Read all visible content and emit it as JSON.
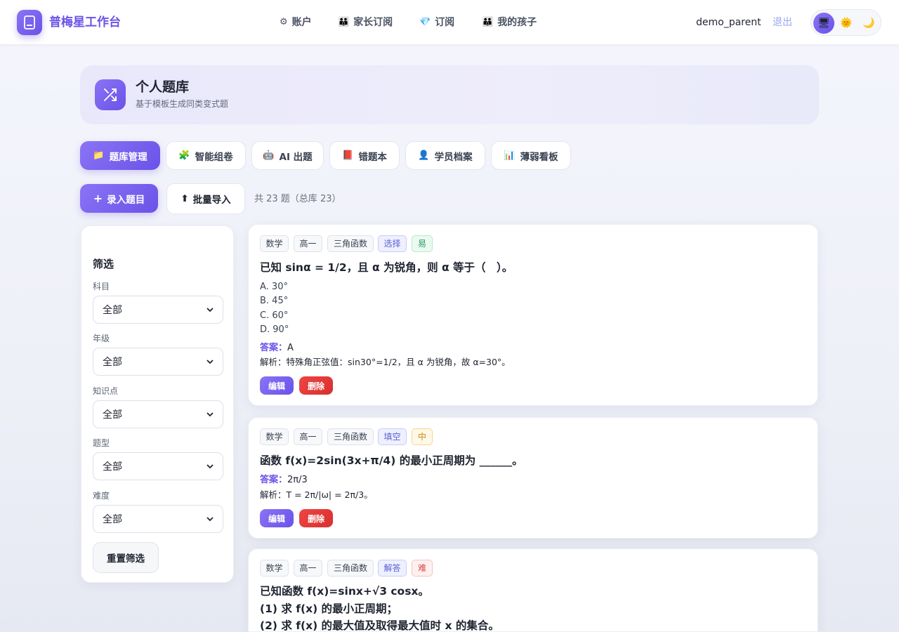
{
  "nav": {
    "brand": "普梅星工作台",
    "links": [
      {
        "icon": "⚙",
        "label": "账户"
      },
      {
        "icon": "👪",
        "label": "家长订阅"
      },
      {
        "icon": "💎",
        "label": "订阅"
      },
      {
        "icon": "👪",
        "label": "我的孩子"
      }
    ],
    "username": "demo_parent",
    "logout": "退出",
    "theme": {
      "system_icon": "🖥",
      "light_icon": "🌞",
      "dark_icon": "🌙"
    }
  },
  "hero": {
    "title": "个人题库",
    "subtitle": "基于模板生成同类变式题"
  },
  "tabs": [
    {
      "icon": "📁",
      "label": "题库管理"
    },
    {
      "icon": "🧩",
      "label": "智能组卷"
    },
    {
      "icon": "🤖",
      "label": "AI 出题"
    },
    {
      "icon": "📕",
      "label": "错题本"
    },
    {
      "icon": "👤",
      "label": "学员档案"
    },
    {
      "icon": "📊",
      "label": "薄弱看板"
    }
  ],
  "actions": {
    "add": "录入题目",
    "add_icon": "+",
    "import": "批量导入",
    "import_icon": "⬆",
    "count": "共 23 题（总库 23）"
  },
  "filter": {
    "title": "筛选",
    "fields": [
      {
        "label": "科目",
        "value": "全部"
      },
      {
        "label": "年级",
        "value": "全部"
      },
      {
        "label": "知识点",
        "value": "全部"
      },
      {
        "label": "题型",
        "value": "全部"
      },
      {
        "label": "难度",
        "value": "全部"
      }
    ],
    "reset": "重置筛选"
  },
  "questions": [
    {
      "tags": [
        "数学",
        "高一",
        "三角函数",
        "选择",
        "易"
      ],
      "title": "已知 sinα = 1/2，且 α 为锐角，则 α 等于（　）。",
      "options": [
        "A. 30°",
        "B. 45°",
        "C. 60°",
        "D. 90°"
      ],
      "answer_label": "答案：",
      "answer": "A",
      "explanation": "解析：特殊角正弦值：sin30°=1/2，且 α 为锐角，故 α=30°。",
      "edit": "编辑",
      "delete": "删除"
    },
    {
      "tags": [
        "数学",
        "高一",
        "三角函数",
        "填空",
        "中"
      ],
      "title": "函数 f(x)=2sin(3x+π/4) 的最小正周期为 ______。",
      "answer_label": "答案：",
      "answer": "2π/3",
      "explanation": "解析：T = 2π/|ω| = 2π/3。",
      "edit": "编辑",
      "delete": "删除"
    },
    {
      "tags": [
        "数学",
        "高一",
        "三角函数",
        "解答",
        "难"
      ],
      "title_lines": [
        "已知函数 f(x)=sinx+√3 cosx。",
        "(1) 求 f(x) 的最小正周期；",
        "(2) 求 f(x) 的最大值及取得最大值时 x 的集合。"
      ]
    }
  ]
}
